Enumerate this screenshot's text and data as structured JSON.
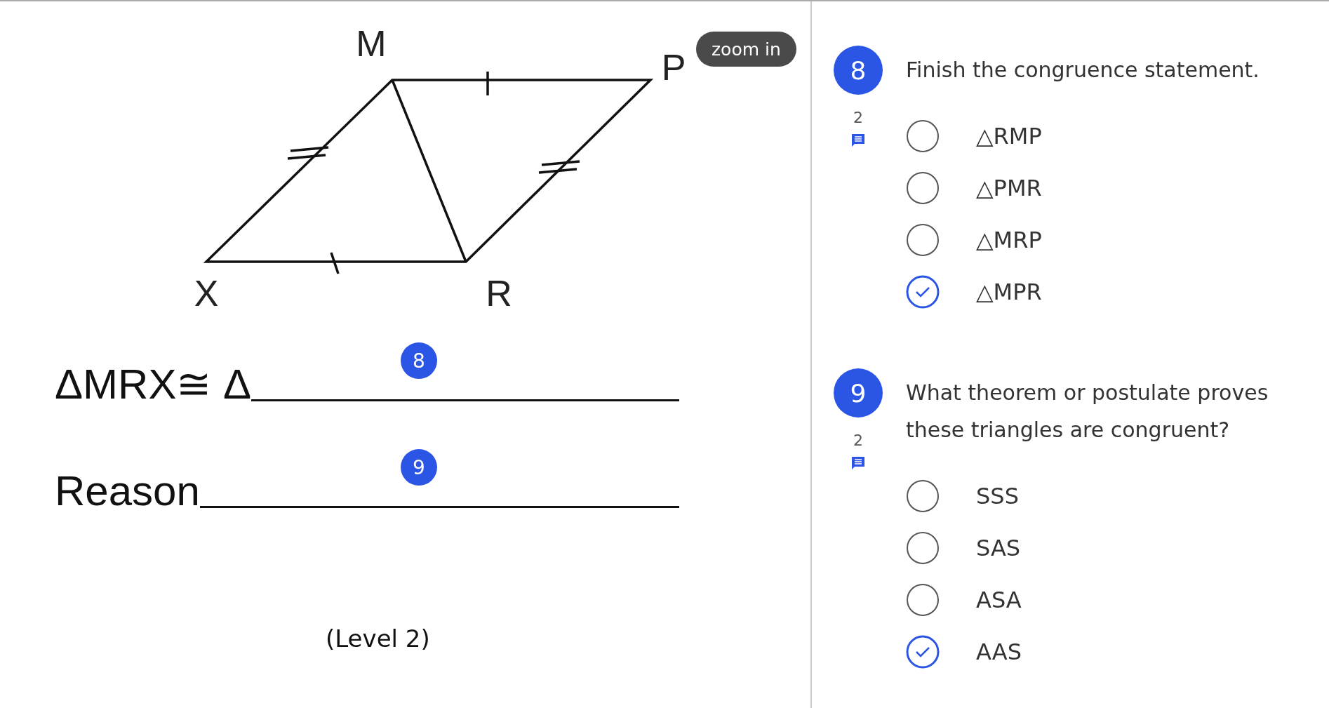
{
  "document": {
    "vertex_labels": [
      "M",
      "P",
      "X",
      "R"
    ],
    "zoom_button": "zoom in",
    "blanks": [
      {
        "prefix": "ΔMRX≅ Δ",
        "badge": "8"
      },
      {
        "prefix": "Reason",
        "badge": "9"
      }
    ],
    "level_note": "(Level 2)"
  },
  "questions": [
    {
      "number": "8",
      "comment_count": "2",
      "prompt": "Finish the congruence statement.",
      "options": [
        {
          "label": "△RMP",
          "selected": false
        },
        {
          "label": "△PMR",
          "selected": false
        },
        {
          "label": "△MRP",
          "selected": false
        },
        {
          "label": "△MPR",
          "selected": true
        }
      ]
    },
    {
      "number": "9",
      "comment_count": "2",
      "prompt": "What theorem or postulate proves these triangles are congruent?",
      "options": [
        {
          "label": "SSS",
          "selected": false
        },
        {
          "label": "SAS",
          "selected": false
        },
        {
          "label": "ASA",
          "selected": false
        },
        {
          "label": "AAS",
          "selected": true
        }
      ]
    }
  ]
}
